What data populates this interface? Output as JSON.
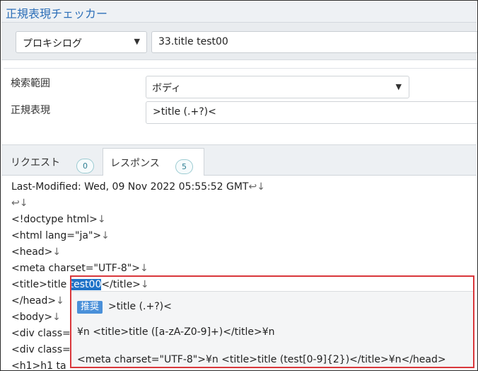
{
  "app": {
    "title": "正規表現チェッカー"
  },
  "toolbar": {
    "source_select": "プロキシログ",
    "target_value": "33.title test00"
  },
  "form": {
    "scope_label": "検索範囲",
    "scope_value": "ボディ",
    "regex_label": "正規表現",
    "regex_value": ">title (.+?)<"
  },
  "tabs": [
    {
      "label": "リクエスト",
      "count": "0"
    },
    {
      "label": "レスポンス",
      "count": "5"
    }
  ],
  "response": {
    "lines": [
      "Last-Modified: Wed, 09 Nov 2022 05:55:52 GMT",
      "",
      "<!doctype html>",
      "<html lang=\"ja\">",
      "<head>",
      "<meta charset=\"UTF-8\">",
      "<title>title ",
      "</head>",
      "<body>",
      "<div class=",
      "<div class=",
      "<h1>h1 ta"
    ],
    "match_text": "test00",
    "after_match": "</title>"
  },
  "suggestions": {
    "recommended_badge": "推奨",
    "items": [
      ">title (.+?)<",
      "¥n <title>title ([a-zA-Z0-9]+)</title>¥n",
      "<meta charset=\"UTF-8\">¥n <title>title (test[0-9]{2})</title>¥n</head>"
    ]
  },
  "colors": {
    "accent": "#2d6fb8",
    "highlight": "#1f73c8",
    "suggestion_border": "#d9373b",
    "badge": "#4a90d9"
  }
}
